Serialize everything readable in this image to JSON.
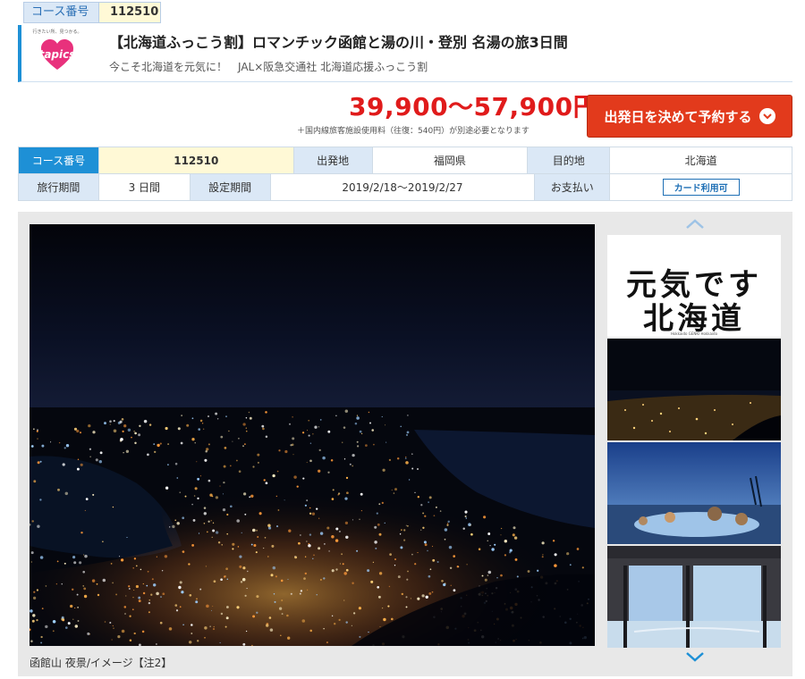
{
  "course_tag": {
    "label": "コース番号",
    "value": "112510"
  },
  "header": {
    "logo_tagline": "行きたい所、見つかる。",
    "logo_brand": "tapics",
    "title": "【北海道ふっこう割】ロマンチック函館と湯の川・登別 名湯の旅3日間",
    "subtitle": "今こそ北海道を元気に！　JAL×阪急交通社 北海道応援ふっこう割"
  },
  "price": {
    "range": "39,900〜57,900円",
    "note": "＋国内線旅客施設使用料（往復：540円）が別途必要となります"
  },
  "book_button": {
    "label": "出発日を決めて予約する"
  },
  "info": {
    "course_no_label": "コース番号",
    "course_no": "112510",
    "departure_label": "出発地",
    "departure": "福岡県",
    "destination_label": "目的地",
    "destination": "北海道",
    "duration_label": "旅行期間",
    "duration": "3 日間",
    "period_label": "設定期間",
    "period": "2019/2/18〜2019/2/27",
    "payment_label": "お支払い",
    "payment": "カード利用可"
  },
  "gallery": {
    "caption": "函館山 夜景/イメージ【注2】",
    "thumb1_line1": "元気です",
    "thumb1_line2": "北海道",
    "thumb1_tiny": "Hokkaido GENKI Hokkaido"
  },
  "colors": {
    "accent_blue": "#1e90d6",
    "price_red": "#e01b1b",
    "button_red": "#e23a1c",
    "highlight_yellow": "#fff9d6"
  }
}
